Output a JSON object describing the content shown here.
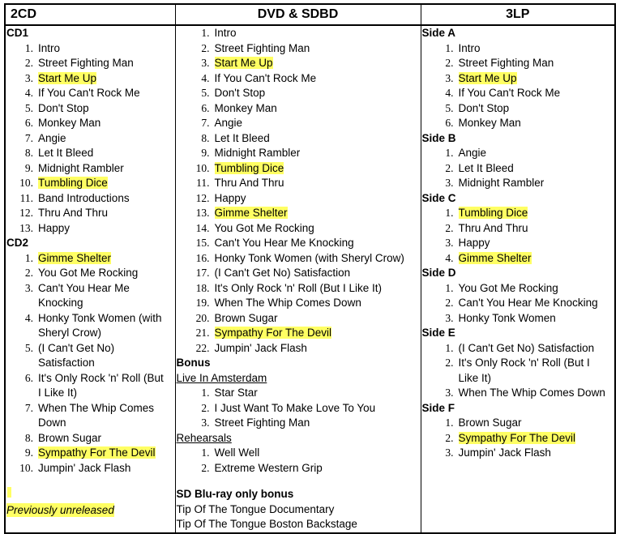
{
  "table": {
    "columns": [
      {
        "id": "2cd",
        "header": "2CD",
        "header_align": "left"
      },
      {
        "id": "dvd",
        "header": "DVD & SDBD",
        "header_align": "center"
      },
      {
        "id": "3lp",
        "header": "3LP",
        "header_align": "center"
      }
    ]
  },
  "highlight_color": "#ffff63",
  "col_2cd": {
    "groups": [
      {
        "title": "CD1",
        "tracks": [
          {
            "n": "1.",
            "title": "Intro",
            "highlight": false
          },
          {
            "n": "2.",
            "title": "Street Fighting Man",
            "highlight": false
          },
          {
            "n": "3.",
            "title": "Start Me Up",
            "highlight": true
          },
          {
            "n": "4.",
            "title": "If You Can't Rock Me",
            "highlight": false
          },
          {
            "n": "5.",
            "title": "Don't Stop",
            "highlight": false
          },
          {
            "n": "6.",
            "title": "Monkey Man",
            "highlight": false
          },
          {
            "n": "7.",
            "title": "Angie",
            "highlight": false
          },
          {
            "n": "8.",
            "title": "Let It Bleed",
            "highlight": false
          },
          {
            "n": "9.",
            "title": "Midnight Rambler",
            "highlight": false
          },
          {
            "n": "10.",
            "title": "Tumbling Dice",
            "highlight": true
          },
          {
            "n": "11.",
            "title": "Band Introductions",
            "highlight": false
          },
          {
            "n": "12.",
            "title": "Thru And Thru",
            "highlight": false
          },
          {
            "n": "13.",
            "title": "Happy",
            "highlight": false
          }
        ]
      },
      {
        "title": "CD2",
        "tracks": [
          {
            "n": "1.",
            "title": "Gimme Shelter",
            "highlight": true
          },
          {
            "n": "2.",
            "title": "You Got Me Rocking",
            "highlight": false
          },
          {
            "n": "3.",
            "title": "Can't You Hear Me Knocking",
            "highlight": false
          },
          {
            "n": "4.",
            "title": "Honky Tonk Women (with Sheryl Crow)",
            "highlight": false
          },
          {
            "n": "5.",
            "title": "(I Can't Get No) Satisfaction",
            "highlight": false
          },
          {
            "n": "6.",
            "title": "It's Only Rock 'n' Roll (But I Like It)",
            "highlight": false
          },
          {
            "n": "7.",
            "title": "When The Whip Comes Down",
            "highlight": false
          },
          {
            "n": "8.",
            "title": "Brown Sugar",
            "highlight": false
          },
          {
            "n": "9.",
            "title": "Sympathy For The Devil",
            "highlight": true
          },
          {
            "n": "10.",
            "title": "Jumpin' Jack Flash",
            "highlight": false
          }
        ]
      }
    ],
    "legend": "Previously unreleased"
  },
  "col_dvd": {
    "main_tracks": [
      {
        "n": "1.",
        "title": "Intro",
        "highlight": false
      },
      {
        "n": "2.",
        "title": "Street Fighting Man",
        "highlight": false
      },
      {
        "n": "3.",
        "title": "Start Me Up",
        "highlight": true
      },
      {
        "n": "4.",
        "title": "If You Can't Rock Me",
        "highlight": false
      },
      {
        "n": "5.",
        "title": "Don't Stop",
        "highlight": false
      },
      {
        "n": "6.",
        "title": "Monkey Man",
        "highlight": false
      },
      {
        "n": "7.",
        "title": "Angie",
        "highlight": false
      },
      {
        "n": "8.",
        "title": "Let It Bleed",
        "highlight": false
      },
      {
        "n": "9.",
        "title": "Midnight Rambler",
        "highlight": false
      },
      {
        "n": "10.",
        "title": "Tumbling Dice",
        "highlight": true
      },
      {
        "n": "11.",
        "title": "Thru And Thru",
        "highlight": false
      },
      {
        "n": "12.",
        "title": "Happy",
        "highlight": false
      },
      {
        "n": "13.",
        "title": "Gimme Shelter",
        "highlight": true
      },
      {
        "n": "14.",
        "title": "You Got Me Rocking",
        "highlight": false
      },
      {
        "n": "15.",
        "title": "Can't You Hear Me Knocking",
        "highlight": false
      },
      {
        "n": "16.",
        "title": "Honky Tonk Women (with Sheryl Crow)",
        "highlight": false
      },
      {
        "n": "17.",
        "title": "(I Can't Get No) Satisfaction",
        "highlight": false
      },
      {
        "n": "18.",
        "title": "It's Only Rock 'n' Roll (But I Like It)",
        "highlight": false
      },
      {
        "n": "19.",
        "title": "When The Whip Comes Down",
        "highlight": false
      },
      {
        "n": "20.",
        "title": "Brown Sugar",
        "highlight": false
      },
      {
        "n": "21.",
        "title": "Sympathy For The Devil",
        "highlight": true
      },
      {
        "n": "22.",
        "title": "Jumpin' Jack Flash",
        "highlight": false
      }
    ],
    "bonus_heading": "Bonus",
    "bonus_sections": [
      {
        "title": "Live In Amsterdam",
        "tracks": [
          {
            "n": "1.",
            "title": "Star Star",
            "highlight": false
          },
          {
            "n": "2.",
            "title": "I Just Want To Make Love To You",
            "highlight": false
          },
          {
            "n": "3.",
            "title": "Street Fighting Man",
            "highlight": false
          }
        ]
      },
      {
        "title": "Rehearsals",
        "tracks": [
          {
            "n": "1.",
            "title": "Well Well",
            "highlight": false
          },
          {
            "n": "2.",
            "title": "Extreme Western Grip",
            "highlight": false
          }
        ]
      }
    ],
    "bluray_heading": "SD Blu-ray only bonus",
    "bluray_items": [
      "Tip Of The Tongue Documentary",
      "Tip Of The Tongue Boston Backstage"
    ]
  },
  "col_3lp": {
    "groups": [
      {
        "title": "Side A",
        "tracks": [
          {
            "n": "1.",
            "title": "Intro",
            "highlight": false
          },
          {
            "n": "2.",
            "title": "Street Fighting Man",
            "highlight": false
          },
          {
            "n": "3.",
            "title": "Start Me Up",
            "highlight": true
          },
          {
            "n": "4.",
            "title": "If You Can't Rock Me",
            "highlight": false
          },
          {
            "n": "5.",
            "title": "Don't Stop",
            "highlight": false
          },
          {
            "n": "6.",
            "title": "Monkey Man",
            "highlight": false
          }
        ]
      },
      {
        "title": "Side B",
        "tracks": [
          {
            "n": "1.",
            "title": "Angie",
            "highlight": false
          },
          {
            "n": "2.",
            "title": "Let It Bleed",
            "highlight": false
          },
          {
            "n": "3.",
            "title": "Midnight Rambler",
            "highlight": false
          }
        ]
      },
      {
        "title": "Side C",
        "tracks": [
          {
            "n": "1.",
            "title": "Tumbling Dice",
            "highlight": true
          },
          {
            "n": "2.",
            "title": "Thru And Thru",
            "highlight": false
          },
          {
            "n": "3.",
            "title": "Happy",
            "highlight": false
          },
          {
            "n": "4.",
            "title": "Gimme Shelter",
            "highlight": true
          }
        ]
      },
      {
        "title": "Side D",
        "tracks": [
          {
            "n": "1.",
            "title": "You Got Me Rocking",
            "highlight": false
          },
          {
            "n": "2.",
            "title": "Can't You Hear Me Knocking",
            "highlight": false
          },
          {
            "n": "3.",
            "title": "Honky Tonk Women",
            "highlight": false
          }
        ]
      },
      {
        "title": "Side E",
        "tracks": [
          {
            "n": "1.",
            "title": "(I Can't Get No) Satisfaction",
            "highlight": false
          },
          {
            "n": "2.",
            "title": "It's Only Rock 'n' Roll (But I Like It)",
            "highlight": false
          },
          {
            "n": "3.",
            "title": "When The Whip Comes Down",
            "highlight": false
          }
        ]
      },
      {
        "title": "Side F",
        "tracks": [
          {
            "n": "1.",
            "title": "Brown Sugar",
            "highlight": false
          },
          {
            "n": "2.",
            "title": "Sympathy For The Devil",
            "highlight": true
          },
          {
            "n": "3.",
            "title": "Jumpin' Jack Flash",
            "highlight": false
          }
        ]
      }
    ]
  }
}
